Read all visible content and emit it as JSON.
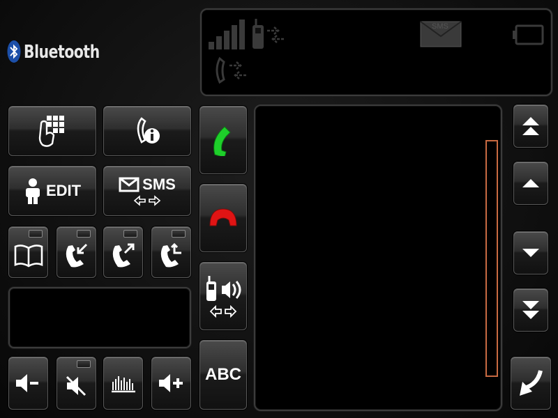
{
  "header": {
    "brand_label": "Bluetooth",
    "status_sms_label": "SMS"
  },
  "buttons": {
    "edit_label": "EDIT",
    "sms_label": "SMS",
    "abc_label": "ABC"
  },
  "colors": {
    "accept_call": "#1ecf2a",
    "reject_call": "#e01414",
    "scroll_track": "#c96a42",
    "status_icons": "#3a3a3a"
  },
  "icons": {
    "bluetooth": "bluetooth-icon",
    "signal": "signal-strength-icon",
    "phone_transfer": "phone-transfer-icon",
    "sms_envelope": "sms-envelope-icon",
    "battery": "battery-icon",
    "keypad": "keypad-icon",
    "call_info": "call-info-icon",
    "contact": "contact-person-icon",
    "phonebook": "phonebook-icon",
    "missed_calls": "missed-calls-icon",
    "dialed_calls": "dialed-calls-icon",
    "received_calls": "received-calls-icon",
    "accept_call": "accept-call-icon",
    "end_call": "end-call-icon",
    "handsfree": "handsfree-switch-icon",
    "volume_down": "volume-down-icon",
    "mute": "mute-icon",
    "equalizer": "equalizer-icon",
    "volume_up": "volume-up-icon",
    "scroll_top": "scroll-to-top-icon",
    "scroll_up": "scroll-up-icon",
    "scroll_down": "scroll-down-icon",
    "scroll_bottom": "scroll-to-bottom-icon",
    "back": "back-arrow-icon"
  }
}
